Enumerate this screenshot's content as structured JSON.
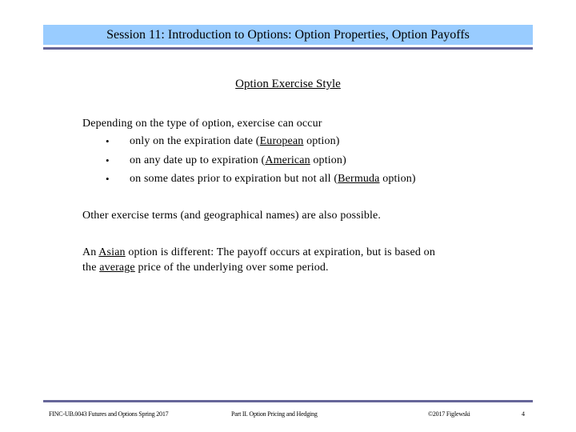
{
  "header": {
    "title": "Session 11:  Introduction to Options: Option Properties, Option Payoffs",
    "bar_color": "#99ccff",
    "rule_color": "#666699"
  },
  "slide": {
    "heading": "Option Exercise Style",
    "intro": "Depending on the type of option, exercise can occur",
    "bullets": [
      {
        "before": "only on the expiration date (",
        "term": "European",
        "after": " option)"
      },
      {
        "before": "on any date up to expiration (",
        "term": "American",
        "after": " option)"
      },
      {
        "before": "on some dates prior to expiration but not all (",
        "term": "Bermuda",
        "after": " option)"
      }
    ],
    "bullet_glyph": "•",
    "other_terms": "Other exercise terms (and geographical names) are also possible.",
    "asian": {
      "part1": "An ",
      "term1": "Asian",
      "part2": " option is different: The payoff occurs at expiration, but is based on",
      "part3": "the ",
      "term2": "average",
      "part4": " price of the underlying over some period."
    }
  },
  "footer": {
    "course": "FINC-UB.0043  Futures and Options  Spring 2017",
    "part": "Part II. Option Pricing and Hedging",
    "copyright": "©2017 Figlewski",
    "page_number": "4"
  }
}
